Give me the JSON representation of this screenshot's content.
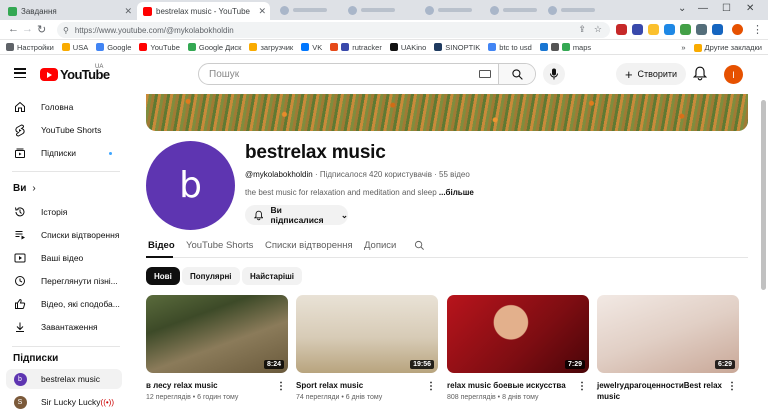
{
  "browser": {
    "tabs": [
      {
        "title": "Завдання",
        "active": false
      },
      {
        "title": "bestrelax music - YouTube",
        "active": true
      }
    ],
    "url": "https://www.youtube.com/@mykolabokholdin",
    "bookmarks": [
      "Настройки",
      "USA",
      "Google",
      "YouTube",
      "Google Диск",
      "загрузчик",
      "VK",
      "rutracker",
      "UAKino",
      "SINOPTIK",
      "btc to usd",
      "maps"
    ],
    "bookmarks_right": "Другие закладки"
  },
  "header": {
    "logo": "YouTube",
    "country_code": "UA",
    "search_placeholder": "Пошук",
    "create_label": "Створити",
    "avatar_letter": "I"
  },
  "sidebar": {
    "main": [
      {
        "label": "Головна",
        "icon": "home-icon"
      },
      {
        "label": "YouTube Shorts",
        "icon": "shorts-icon"
      },
      {
        "label": "Підписки",
        "icon": "subscriptions-icon"
      }
    ],
    "you_heading": "Ви",
    "you": [
      {
        "label": "Історія",
        "icon": "history-icon"
      },
      {
        "label": "Списки відтворення",
        "icon": "playlists-icon"
      },
      {
        "label": "Ваші відео",
        "icon": "your-videos-icon"
      },
      {
        "label": "Переглянути пізні...",
        "icon": "watch-later-icon"
      },
      {
        "label": "Відео, які сподоба...",
        "icon": "like-icon"
      },
      {
        "label": "Завантаження",
        "icon": "download-icon"
      }
    ],
    "subs_heading": "Підписки",
    "subs": [
      {
        "label": "bestrelax music",
        "avatar": "b",
        "color": "#5e35b1"
      },
      {
        "label": "Sir Lucky Lucky",
        "avatar": "S",
        "color": "#7b5a3a"
      }
    ]
  },
  "channel": {
    "avatar_letter": "b",
    "avatar_color": "#5e35b1",
    "name": "bestrelax music",
    "handle": "@mykolabokholdin",
    "stats": " · Підписалося 420 користувачів · 55 відео",
    "description": "the best music for relaxation and meditation and sleep ",
    "more": "...більше",
    "subscribed_label": "Ви підписалися"
  },
  "tabs": [
    "Відео",
    "YouTube Shorts",
    "Списки відтворення",
    "Дописи"
  ],
  "chips": [
    "Нові",
    "Популярні",
    "Найстаріші"
  ],
  "videos": [
    {
      "title": "в лесу relax music",
      "meta": "12 переглядів • 6 годин тому",
      "duration": "8:24"
    },
    {
      "title": "Sport relax music",
      "meta": "74 перегляди • 6 днів тому",
      "duration": "19:56"
    },
    {
      "title": "relax music боевые искусства",
      "meta": "808 переглядів • 8 днів тому",
      "duration": "7:29"
    },
    {
      "title": "jewelryдрагоценностиBest relax music",
      "meta": "",
      "duration": "6:29"
    }
  ]
}
